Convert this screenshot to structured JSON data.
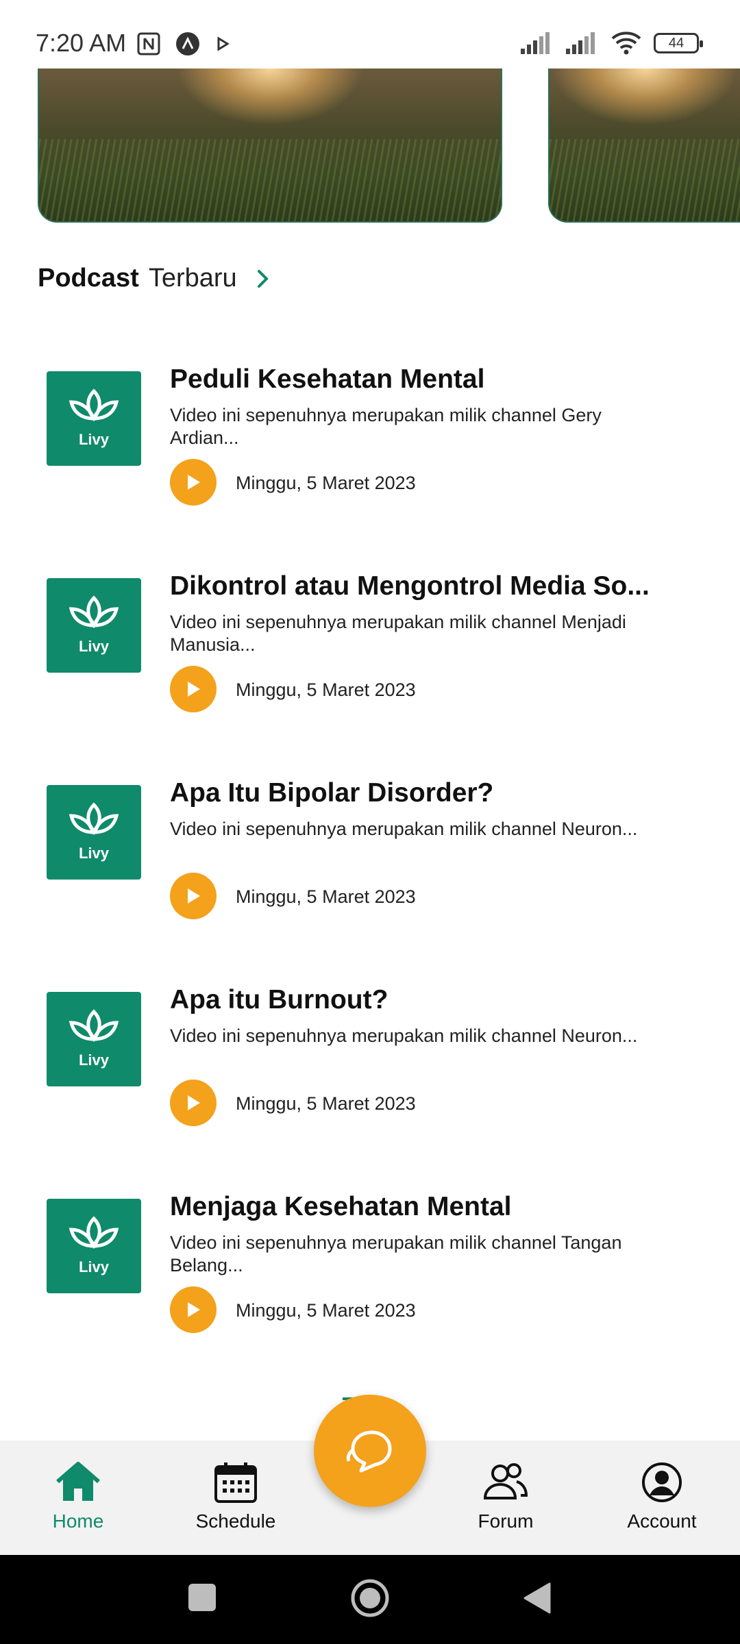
{
  "status_bar": {
    "time": "7:20 AM",
    "battery": "44",
    "icons": [
      "nfc-icon",
      "app-a-icon",
      "play-icon",
      "signal-icon",
      "signal-icon",
      "wifi-icon",
      "battery-icon"
    ]
  },
  "section": {
    "title_bold": "Podcast",
    "title_light": "Terbaru"
  },
  "podcasts": [
    {
      "thumb_label": "Livy",
      "title": "Peduli Kesehatan Mental",
      "description": "Video ini sepenuhnya merupakan milik channel Gery Ardian...",
      "date": "Minggu, 5 Maret 2023"
    },
    {
      "thumb_label": "Livy",
      "title": "Dikontrol atau Mengontrol Media So...",
      "description": "Video ini sepenuhnya merupakan milik channel Menjadi Manusia...",
      "date": "Minggu, 5 Maret 2023"
    },
    {
      "thumb_label": "Livy",
      "title": "Apa Itu Bipolar Disorder?",
      "description": "Video ini sepenuhnya merupakan milik channel Neuron...",
      "date": "Minggu, 5 Maret 2023"
    },
    {
      "thumb_label": "Livy",
      "title": "Apa itu Burnout?",
      "description": "Video ini sepenuhnya merupakan milik channel Neuron...",
      "date": "Minggu, 5 Maret 2023"
    },
    {
      "thumb_label": "Livy",
      "title": "Menjaga Kesehatan Mental",
      "description": "Video ini sepenuhnya merupakan milik channel Tangan Belang...",
      "date": "Minggu, 5 Maret 2023"
    }
  ],
  "bottom_nav": {
    "home": "Home",
    "schedule": "Schedule",
    "forum": "Forum",
    "account": "Account",
    "active": "home"
  },
  "colors": {
    "brand_green": "#0f8a6a",
    "accent_orange": "#f4a11c"
  }
}
